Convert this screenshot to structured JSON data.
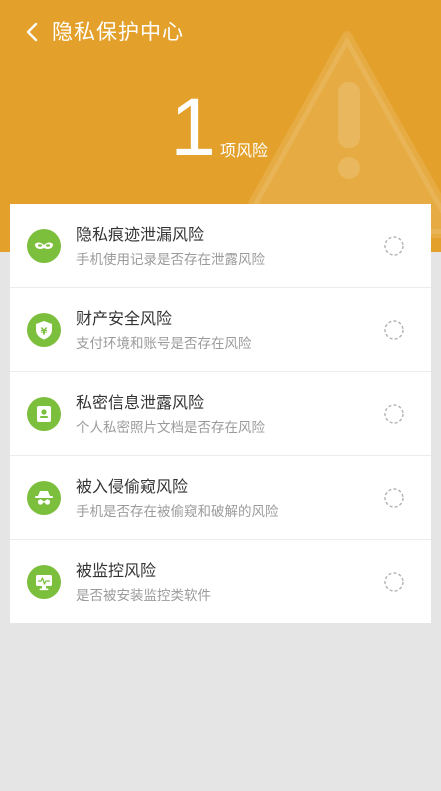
{
  "header": {
    "title": "隐私保护中心",
    "risk_count": "1",
    "risk_unit": "项风险"
  },
  "colors": {
    "header_bg": "#e3a12b",
    "icon_green": "#7bbf3d",
    "page_bg": "#e5e5e5"
  },
  "risks": [
    {
      "title": "隐私痕迹泄漏风险",
      "subtitle": "手机使用记录是否存在泄露风险",
      "icon": "mask-icon"
    },
    {
      "title": "财产安全风险",
      "subtitle": "支付环境和账号是否存在风险",
      "icon": "yen-shield-icon"
    },
    {
      "title": "私密信息泄露风险",
      "subtitle": "个人私密照片文档是否存在风险",
      "icon": "id-card-icon"
    },
    {
      "title": "被入侵偷窥风险",
      "subtitle": "手机是否存在被偷窥和破解的风险",
      "icon": "spy-icon"
    },
    {
      "title": "被监控风险",
      "subtitle": "是否被安装监控类软件",
      "icon": "monitor-icon"
    }
  ]
}
